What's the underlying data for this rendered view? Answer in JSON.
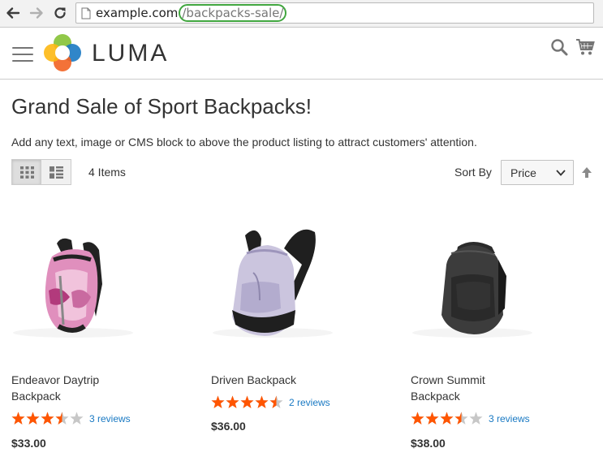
{
  "browser": {
    "url_host": "example.com",
    "url_path": "/backpacks-sale/"
  },
  "header": {
    "logo_text": "LUMA",
    "colors": {
      "logo_orange": "#f26322",
      "logo_green": "#8bc53f",
      "logo_blue": "#1979c3",
      "logo_yellow": "#fdb813"
    }
  },
  "page": {
    "title": "Grand Sale of Sport Backpacks!",
    "cms_text": "Add any text, image or CMS block to above the product listing to attract customers' attention."
  },
  "toolbar": {
    "item_count": "4 Items",
    "sort_label": "Sort By",
    "sort_value": "Price",
    "view_modes": [
      "grid-icon",
      "list-icon"
    ]
  },
  "products": [
    {
      "name": "Endeavor Daytrip Backpack",
      "rating_stars": 3.5,
      "reviews": "3 reviews",
      "price": "$33.00",
      "colors": {
        "main": "#e58fb8",
        "accent": "#b23a7c",
        "straps": "#2a2a2a"
      }
    },
    {
      "name": "Driven Backpack",
      "rating_stars": 4.5,
      "reviews": "2 reviews",
      "price": "$36.00",
      "colors": {
        "main": "#c9c3dc",
        "accent": "#9a92b8",
        "straps": "#1f1f1f"
      }
    },
    {
      "name": "Crown Summit Backpack",
      "rating_stars": 3.5,
      "reviews": "3 reviews",
      "price": "$38.00",
      "colors": {
        "main": "#3b3b3b",
        "accent": "#262626",
        "straps": "#1a1a1a"
      }
    }
  ],
  "colors": {
    "star_filled": "#ff5501",
    "star_empty": "#c7c7c7",
    "link": "#1979c3"
  }
}
